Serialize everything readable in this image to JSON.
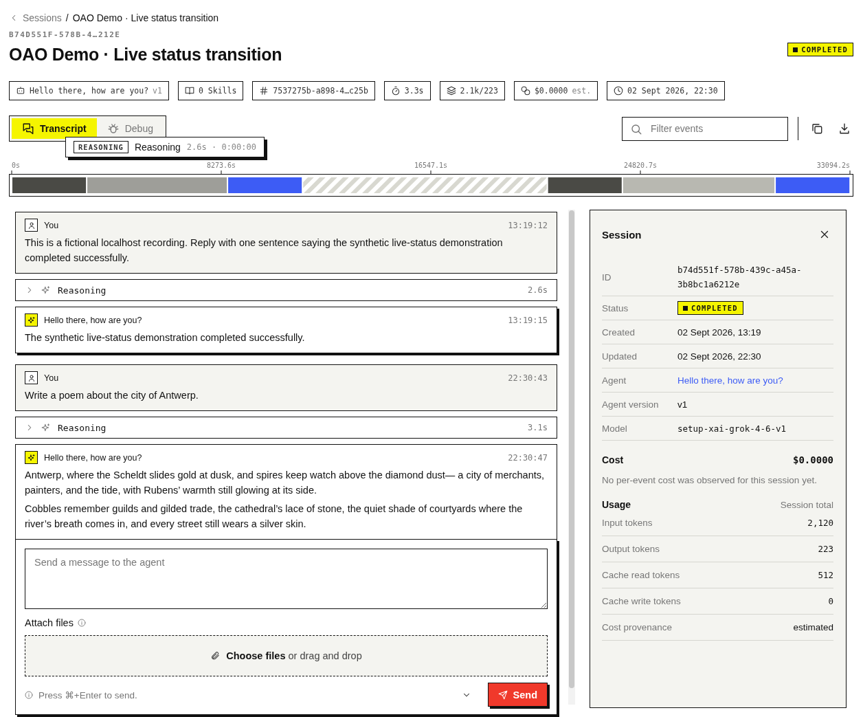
{
  "breadcrumb": {
    "back": "Sessions",
    "separator": "/",
    "current": "OAO Demo · Live status transition"
  },
  "session_code": "B74D551F-578B-4…212E",
  "title": "OAO Demo · Live status transition",
  "status": "COMPLETED",
  "chips": [
    {
      "kind": "robot",
      "text": "Hello there, how are you?",
      "suffix": "v1"
    },
    {
      "kind": "book",
      "text": "0 Skills"
    },
    {
      "kind": "hash",
      "text": "7537275b-a898-4…c25b"
    },
    {
      "kind": "timer",
      "text": "3.3s"
    },
    {
      "kind": "layers",
      "text": "2.1k/223"
    },
    {
      "kind": "coins",
      "text": "$0.0000",
      "suffix": "est."
    },
    {
      "kind": "clock",
      "text": "02 Sept 2026, 22:30"
    }
  ],
  "tabs": [
    {
      "kind": "chat",
      "label": "Transcript",
      "selected": true
    },
    {
      "kind": "bug",
      "label": "Debug",
      "selected": false
    }
  ],
  "tooltip": {
    "tag": "REASONING",
    "label": "Reasoning",
    "meta": "2.6s · 0:00:00"
  },
  "filter": {
    "placeholder": "Filter events"
  },
  "timeline": {
    "chart_data": {
      "type": "bar",
      "orientation": "horizontal",
      "stacked": true,
      "xlim": [
        0,
        33094.2
      ],
      "xticks": [
        {
          "value": 0,
          "label": "0s"
        },
        {
          "value": 8273.6,
          "label": "8273.6s"
        },
        {
          "value": 16547.1,
          "label": "16547.1s"
        },
        {
          "value": 24820.7,
          "label": "24820.7s"
        },
        {
          "value": 33094.2,
          "label": "33094.2s"
        }
      ],
      "series": [
        {
          "color": "#4a4a45",
          "values": [
            2960
          ]
        },
        {
          "color": "#9e9e99",
          "values": [
            5560
          ]
        },
        {
          "color": "#3d5cf5",
          "values": [
            2960
          ]
        },
        {
          "color": "#d8d8d0",
          "values": [
            9670
          ]
        },
        {
          "color": "#4a4a45",
          "values": [
            2960
          ]
        },
        {
          "color": "#b8b8b1",
          "values": [
            6030
          ]
        },
        {
          "color": "#3d5cf5",
          "values": [
            2960
          ]
        }
      ]
    }
  },
  "events": [
    {
      "kind": "user",
      "author": "You",
      "time": "13:19:12",
      "paragraphs": [
        "This is a fictional localhost recording. Reply with one sentence saying the synthetic live-status demonstration completed successfully."
      ]
    },
    {
      "kind": "reasoning",
      "label": "Reasoning",
      "duration": "2.6s",
      "expanded": false
    },
    {
      "kind": "agent",
      "author": "Hello there, how are you?",
      "time": "13:19:15",
      "paragraphs": [
        "The synthetic live-status demonstration completed successfully."
      ]
    },
    {
      "kind": "user",
      "author": "You",
      "time": "22:30:43",
      "paragraphs": [
        "Write a poem about the city of Antwerp."
      ]
    },
    {
      "kind": "reasoning",
      "label": "Reasoning",
      "duration": "3.1s",
      "expanded": false
    },
    {
      "kind": "agent",
      "author": "Hello there, how are you?",
      "time": "22:30:47",
      "paragraphs": [
        "Antwerp, where the Scheldt slides gold at dusk, and spires keep watch above the diamond dust— a city of merchants, painters, and the tide, with Rubens’ warmth still glowing at its side.",
        "Cobbles remember guilds and gilded trade, the cathedral’s lace of stone, the quiet shade of courtyards where the river’s breath comes in, and every street still wears a silver skin."
      ]
    }
  ],
  "composer": {
    "placeholder": "Send a message to the agent",
    "attach_label": "Attach files",
    "drop_text": "**Choose files** or drag and drop",
    "hint": "Press ⌘+Enter to send.",
    "send": "Send"
  },
  "panel": {
    "title": "Session",
    "fields": [
      {
        "kind": "mono",
        "label": "ID",
        "value": "b74d551f-578b-439c-a45a-3b8bc1a6212e"
      },
      {
        "kind": "status",
        "label": "Status",
        "value": "COMPLETED"
      },
      {
        "kind": "text",
        "label": "Created",
        "value": "02 Sept 2026, 13:19"
      },
      {
        "kind": "text",
        "label": "Updated",
        "value": "02 Sept 2026, 22:30"
      },
      {
        "kind": "link",
        "label": "Agent",
        "value": "Hello there, how are you?"
      },
      {
        "kind": "text",
        "label": "Agent version",
        "value": "v1"
      },
      {
        "kind": "mono",
        "label": "Model",
        "value": "setup-xai-grok-4-6-v1"
      }
    ],
    "cost": {
      "label": "Cost",
      "value": "$0.0000",
      "note": "No per-event cost was observed for this session yet."
    },
    "usage": {
      "label": "Usage",
      "scope": "Session total",
      "rows": [
        {
          "kind": "mono",
          "label": "Input tokens",
          "value": "2,120"
        },
        {
          "kind": "mono",
          "label": "Output tokens",
          "value": "223"
        },
        {
          "kind": "mono",
          "label": "Cache read tokens",
          "value": "512"
        },
        {
          "kind": "mono",
          "label": "Cache write tokens",
          "value": "0"
        },
        {
          "kind": "text",
          "label": "Cost provenance",
          "value": "estimated"
        }
      ]
    }
  }
}
